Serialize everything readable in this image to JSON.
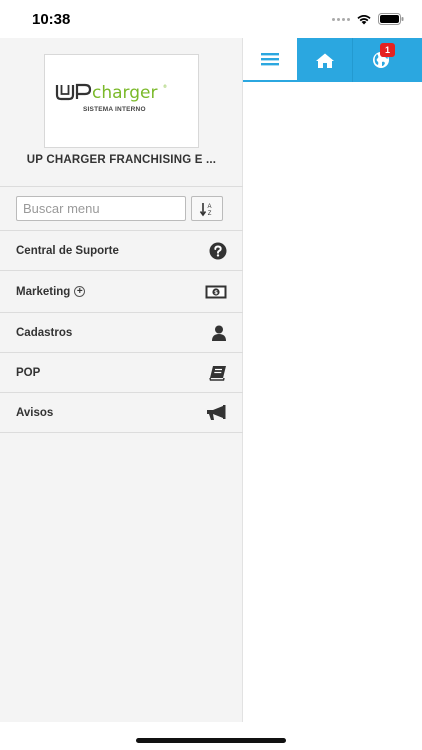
{
  "status_bar": {
    "time": "10:38"
  },
  "logo": {
    "brand_prefix": "UP",
    "brand_name": "charger",
    "tagline": "SISTEMA INTERNO"
  },
  "sidebar": {
    "company_name": "UP CHARGER FRANCHISING E ...",
    "search": {
      "placeholder": "Buscar menu",
      "value": ""
    },
    "menu": [
      {
        "label": "Central de Suporte",
        "icon": "question-circle-icon"
      },
      {
        "label": "Marketing",
        "icon": "money-icon",
        "expandable": true
      },
      {
        "label": "Cadastros",
        "icon": "user-icon"
      },
      {
        "label": "POP",
        "icon": "book-icon"
      },
      {
        "label": "Avisos",
        "icon": "bullhorn-icon"
      }
    ]
  },
  "topnav": {
    "tabs": [
      {
        "name": "menu",
        "icon": "hamburger-icon",
        "active": true
      },
      {
        "name": "home",
        "icon": "home-icon"
      },
      {
        "name": "notifications",
        "icon": "globe-icon"
      }
    ],
    "notification_count": "1"
  },
  "colors": {
    "accent": "#2ba7e0",
    "badge": "#e52121",
    "logo_green": "#7ab929"
  }
}
